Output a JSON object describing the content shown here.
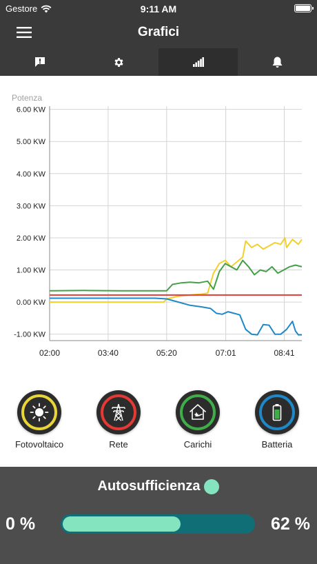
{
  "status_bar": {
    "carrier": "Gestore",
    "time": "9:11 AM"
  },
  "nav": {
    "title": "Grafici"
  },
  "tabs": [
    {
      "name": "alert",
      "icon": "alert-message-icon",
      "active": false
    },
    {
      "name": "settings",
      "icon": "gear-icon",
      "active": false
    },
    {
      "name": "charts",
      "icon": "bar-chart-icon",
      "active": true
    },
    {
      "name": "notifications",
      "icon": "bell-icon",
      "active": false
    }
  ],
  "chart_data": {
    "type": "line",
    "ylabel": "Potenza",
    "y_unit": "KW",
    "ylim": [
      -1.2,
      6.1
    ],
    "y_ticks": [
      "6.00 KW",
      "5.00 KW",
      "4.00 KW",
      "3.00 KW",
      "2.00 KW",
      "1.00 KW",
      "0.00 KW",
      "-1.00 KW"
    ],
    "y_tick_values": [
      6,
      5,
      4,
      3,
      2,
      1,
      0,
      -1
    ],
    "x_ticks": [
      "02:00",
      "03:40",
      "05:20",
      "07:01",
      "08:41"
    ],
    "x_tick_values": [
      "02:00",
      "03:40",
      "05:20",
      "07:01",
      "08:41"
    ],
    "xlim": [
      "02:00",
      "09:11"
    ],
    "grid": true,
    "series": [
      {
        "name": "Fotovoltaico",
        "color": "#f2d02a",
        "points": [
          [
            "02:00",
            0.0
          ],
          [
            "03:00",
            0.0
          ],
          [
            "04:00",
            0.0
          ],
          [
            "05:00",
            0.0
          ],
          [
            "05:15",
            0.0
          ],
          [
            "05:20",
            0.1
          ],
          [
            "05:40",
            0.18
          ],
          [
            "06:00",
            0.22
          ],
          [
            "06:20",
            0.25
          ],
          [
            "06:30",
            0.28
          ],
          [
            "06:40",
            0.9
          ],
          [
            "06:50",
            1.2
          ],
          [
            "07:00",
            1.3
          ],
          [
            "07:10",
            1.1
          ],
          [
            "07:20",
            1.25
          ],
          [
            "07:30",
            1.4
          ],
          [
            "07:35",
            1.9
          ],
          [
            "07:45",
            1.7
          ],
          [
            "07:55",
            1.8
          ],
          [
            "08:05",
            1.65
          ],
          [
            "08:15",
            1.75
          ],
          [
            "08:25",
            1.85
          ],
          [
            "08:35",
            1.8
          ],
          [
            "08:42",
            2.0
          ],
          [
            "08:45",
            1.7
          ],
          [
            "08:55",
            1.95
          ],
          [
            "09:05",
            1.8
          ],
          [
            "09:11",
            1.95
          ]
        ]
      },
      {
        "name": "Rete",
        "color": "#e53935",
        "points": [
          [
            "02:00",
            0.22
          ],
          [
            "03:00",
            0.22
          ],
          [
            "04:00",
            0.22
          ],
          [
            "05:00",
            0.22
          ],
          [
            "06:00",
            0.22
          ],
          [
            "07:00",
            0.22
          ],
          [
            "08:00",
            0.22
          ],
          [
            "09:00",
            0.22
          ],
          [
            "09:11",
            0.22
          ]
        ]
      },
      {
        "name": "Carichi",
        "color": "#43a047",
        "points": [
          [
            "02:00",
            0.35
          ],
          [
            "03:00",
            0.36
          ],
          [
            "04:00",
            0.35
          ],
          [
            "05:00",
            0.35
          ],
          [
            "05:20",
            0.35
          ],
          [
            "05:30",
            0.55
          ],
          [
            "05:45",
            0.6
          ],
          [
            "06:00",
            0.62
          ],
          [
            "06:15",
            0.6
          ],
          [
            "06:30",
            0.65
          ],
          [
            "06:40",
            0.4
          ],
          [
            "06:50",
            0.95
          ],
          [
            "07:00",
            1.2
          ],
          [
            "07:10",
            1.1
          ],
          [
            "07:20",
            1.0
          ],
          [
            "07:30",
            1.3
          ],
          [
            "07:40",
            1.1
          ],
          [
            "07:50",
            0.85
          ],
          [
            "08:00",
            1.0
          ],
          [
            "08:10",
            0.95
          ],
          [
            "08:20",
            1.1
          ],
          [
            "08:30",
            0.9
          ],
          [
            "08:40",
            1.0
          ],
          [
            "08:50",
            1.1
          ],
          [
            "09:00",
            1.15
          ],
          [
            "09:11",
            1.1
          ]
        ]
      },
      {
        "name": "Batteria",
        "color": "#1e88c9",
        "points": [
          [
            "02:00",
            0.12
          ],
          [
            "03:00",
            0.12
          ],
          [
            "04:00",
            0.12
          ],
          [
            "05:00",
            0.12
          ],
          [
            "05:20",
            0.1
          ],
          [
            "05:40",
            0.0
          ],
          [
            "06:00",
            -0.1
          ],
          [
            "06:20",
            -0.15
          ],
          [
            "06:35",
            -0.2
          ],
          [
            "06:45",
            -0.35
          ],
          [
            "06:55",
            -0.38
          ],
          [
            "07:05",
            -0.3
          ],
          [
            "07:15",
            -0.35
          ],
          [
            "07:25",
            -0.4
          ],
          [
            "07:35",
            -0.85
          ],
          [
            "07:45",
            -1.0
          ],
          [
            "07:55",
            -1.02
          ],
          [
            "08:05",
            -0.7
          ],
          [
            "08:15",
            -0.72
          ],
          [
            "08:25",
            -1.0
          ],
          [
            "08:35",
            -1.0
          ],
          [
            "08:45",
            -0.85
          ],
          [
            "08:55",
            -0.6
          ],
          [
            "09:00",
            -0.9
          ],
          [
            "09:05",
            -1.02
          ],
          [
            "09:11",
            -1.02
          ]
        ]
      }
    ]
  },
  "legend": [
    {
      "label": "Fotovoltaico",
      "color": "#e8d53a",
      "icon": "sun-icon"
    },
    {
      "label": "Rete",
      "color": "#e53935",
      "icon": "power-pylon-icon"
    },
    {
      "label": "Carichi",
      "color": "#3fae49",
      "icon": "house-plug-icon"
    },
    {
      "label": "Batteria",
      "color": "#1e88c9",
      "icon": "battery-icon"
    }
  ],
  "self_sufficiency": {
    "title": "Autosufficienza",
    "min_label": "0 %",
    "max_label": "62 %",
    "value_percent": 62,
    "indicator_color": "#85e4c0",
    "track_color": "#0f6e76"
  }
}
